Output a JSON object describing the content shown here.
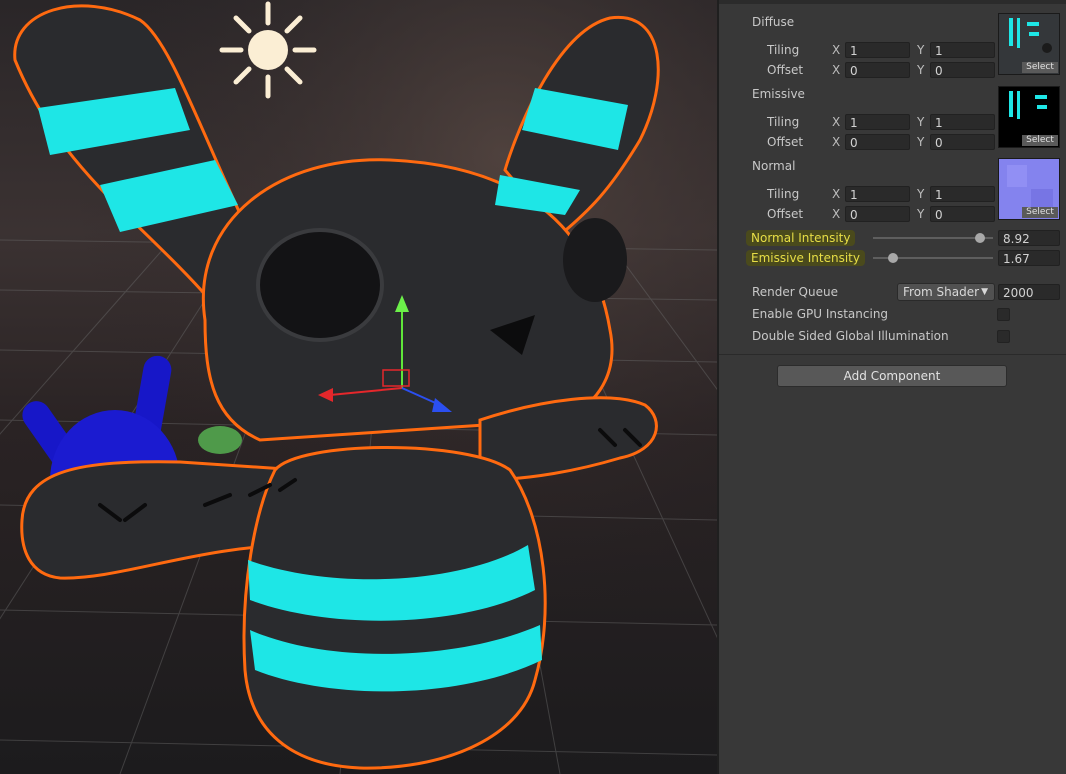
{
  "inspector": {
    "textures": [
      {
        "label": "Diffuse",
        "tiling_label": "Tiling",
        "offset_label": "Offset",
        "tiling": {
          "x": "1",
          "y": "1"
        },
        "offset": {
          "x": "0",
          "y": "0"
        },
        "select_label": "Select"
      },
      {
        "label": "Emissive",
        "tiling_label": "Tiling",
        "offset_label": "Offset",
        "tiling": {
          "x": "1",
          "y": "1"
        },
        "offset": {
          "x": "0",
          "y": "0"
        },
        "select_label": "Select"
      },
      {
        "label": "Normal",
        "tiling_label": "Tiling",
        "offset_label": "Offset",
        "tiling": {
          "x": "1",
          "y": "1"
        },
        "offset": {
          "x": "0",
          "y": "0"
        },
        "select_label": "Select"
      }
    ],
    "axis_x": "X",
    "axis_y": "Y",
    "normal_intensity": {
      "label": "Normal Intensity",
      "value": "8.92",
      "fraction": 0.89
    },
    "emissive_intensity": {
      "label": "Emissive Intensity",
      "value": "1.67",
      "fraction": 0.17
    },
    "render_queue": {
      "label": "Render Queue",
      "option": "From Shader",
      "value": "2000"
    },
    "gpu_instancing": {
      "label": "Enable GPU Instancing",
      "checked": false
    },
    "double_sided_gi": {
      "label": "Double Sided Global Illumination",
      "checked": false
    },
    "add_component_label": "Add Component"
  },
  "colors": {
    "accent_cyan": "#1ee6e6",
    "selection_orange": "#ff6a10",
    "highlight_yellow": "#e7de46"
  },
  "icons": {
    "sun": "sun-icon",
    "gizmo": "transform-gizmo-icon",
    "dropdown": "caret-down-icon"
  }
}
